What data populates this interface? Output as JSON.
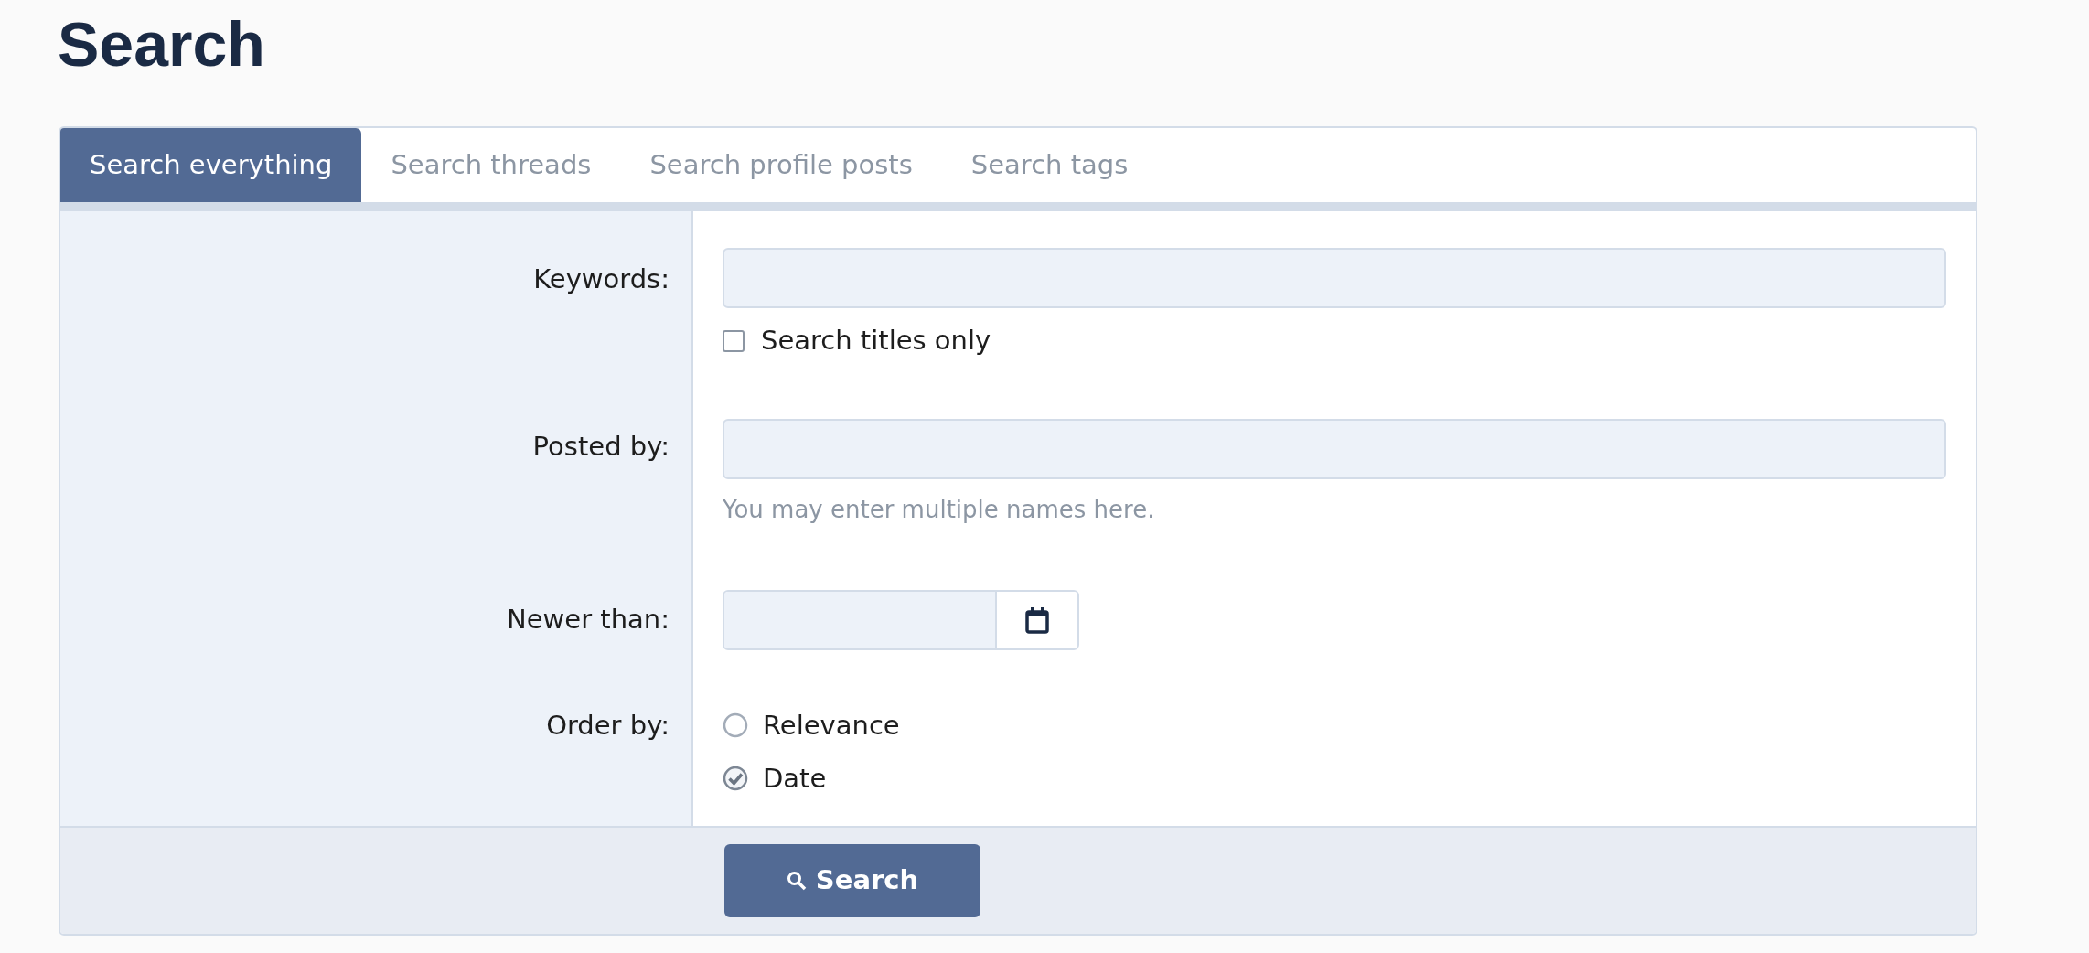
{
  "page_title": "Search",
  "tabs": [
    {
      "label": "Search everything",
      "selected": true
    },
    {
      "label": "Search threads",
      "selected": false
    },
    {
      "label": "Search profile posts",
      "selected": false
    },
    {
      "label": "Search tags",
      "selected": false
    }
  ],
  "form": {
    "keywords": {
      "label": "Keywords:",
      "checkbox": {
        "label": "Search titles only",
        "checked": false
      }
    },
    "posted_by": {
      "label": "Posted by:",
      "hint": "You may enter multiple names here."
    },
    "newer_than": {
      "label": "Newer than:"
    },
    "order_by": {
      "label": "Order by:",
      "options": [
        {
          "label": "Relevance",
          "selected": false
        },
        {
          "label": "Date",
          "selected": true
        }
      ]
    }
  },
  "submit_button": "Search"
}
